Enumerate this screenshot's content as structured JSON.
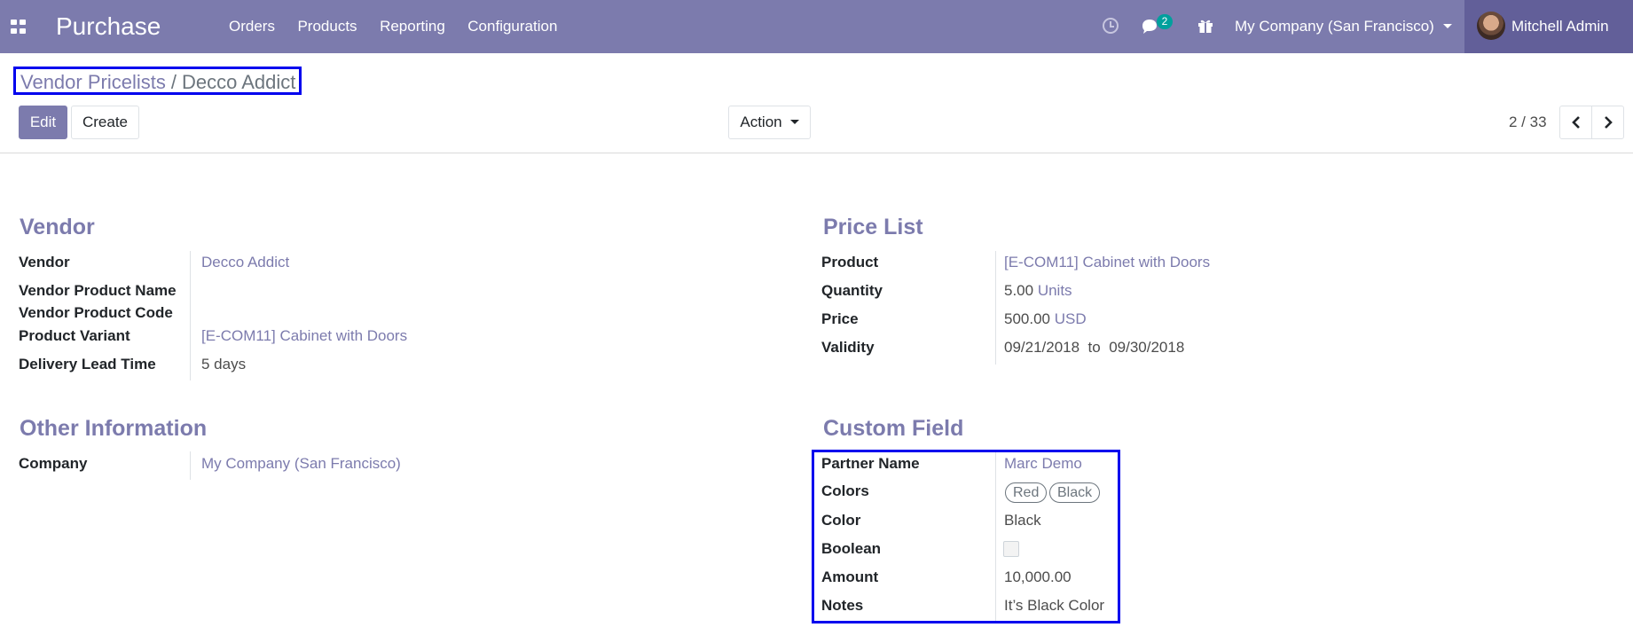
{
  "navbar": {
    "app_name": "Purchase",
    "menu": [
      "Orders",
      "Products",
      "Reporting",
      "Configuration"
    ],
    "badge_count": "2",
    "company": "My Company (San Francisco)",
    "user": "Mitchell Admin"
  },
  "breadcrumb": {
    "parent": "Vendor Pricelists",
    "separator": "/",
    "current": "Decco Addict"
  },
  "toolbar": {
    "edit_label": "Edit",
    "create_label": "Create",
    "action_label": "Action",
    "pager": "2 / 33"
  },
  "vendor": {
    "title": "Vendor",
    "vendor_label": "Vendor",
    "vendor_value": "Decco Addict",
    "product_name_label": "Vendor Product Name",
    "product_code_label": "Vendor Product Code",
    "variant_label": "Product Variant",
    "variant_value": "[E-COM11] Cabinet with Doors",
    "lead_label": "Delivery Lead Time",
    "lead_value": "5 days"
  },
  "price_list": {
    "title": "Price List",
    "product_label": "Product",
    "product_value": "[E-COM11] Cabinet with Doors",
    "quantity_label": "Quantity",
    "quantity_value": "5.00",
    "quantity_unit": "Units",
    "price_label": "Price",
    "price_value": "500.00",
    "price_currency": "USD",
    "validity_label": "Validity",
    "validity_from": "09/21/2018",
    "validity_to_word": "to",
    "validity_to": "09/30/2018"
  },
  "other_info": {
    "title": "Other Information",
    "company_label": "Company",
    "company_value": "My Company (San Francisco)"
  },
  "custom_field": {
    "title": "Custom Field",
    "partner_label": "Partner Name",
    "partner_value": "Marc Demo",
    "colors_label": "Colors",
    "colors_tags": [
      "Red",
      "Black"
    ],
    "color_label": "Color",
    "color_value": "Black",
    "boolean_label": "Boolean",
    "boolean_checked": false,
    "amount_label": "Amount",
    "amount_value": "10,000.00",
    "notes_label": "Notes",
    "notes_value": "It’s Black Color"
  },
  "colors": {
    "brand": "#7c7bad",
    "user_box": "#625f99",
    "badge": "#00a09d",
    "highlight_outline": "#0000ee"
  }
}
